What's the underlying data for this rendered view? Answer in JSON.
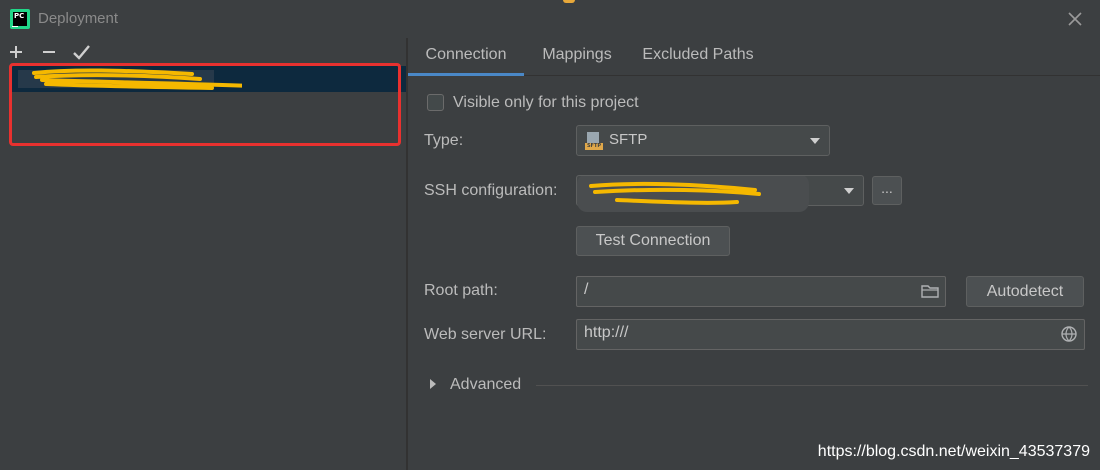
{
  "window": {
    "title": "Deployment",
    "app_icon_text": "PC",
    "close_icon": "close-icon"
  },
  "toolbar": {
    "add_icon": "plus-icon",
    "remove_icon": "minus-icon",
    "default_icon": "check-icon"
  },
  "server_list": {
    "selected_server_name": "(obscured)"
  },
  "tabs": [
    {
      "label": "Connection",
      "active": true
    },
    {
      "label": "Mappings",
      "active": false
    },
    {
      "label": "Excluded Paths",
      "active": false
    }
  ],
  "connection": {
    "visible_only_label": "Visible only for this project",
    "visible_only_checked": false,
    "type_label": "Type:",
    "type_value": "SFTP",
    "type_icon_text": "SFTP",
    "ssh_label": "SSH configuration:",
    "ssh_value": "(obscured)",
    "ssh_browse_label": "...",
    "test_connection_label": "Test Connection",
    "root_path_label": "Root path:",
    "root_path_value": "/",
    "autodetect_label": "Autodetect",
    "web_url_label": "Web server URL:",
    "web_url_value": "http:///",
    "advanced_label": "Advanced"
  },
  "watermark": "https://blog.csdn.net/weixin_43537379",
  "colors": {
    "background": "#3c3f41",
    "selection": "#0d293e",
    "tab_underline": "#4a88c7",
    "highlight_border": "#e8312f",
    "scribble": "#f5b800"
  }
}
